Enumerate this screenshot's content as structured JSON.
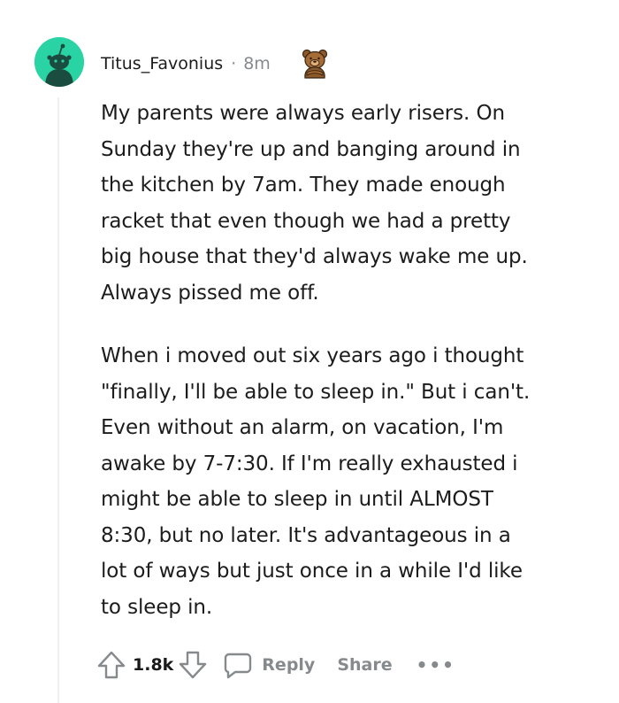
{
  "comment": {
    "author": "Titus_Favonius",
    "separator": "·",
    "timestamp": "8m",
    "award_icon": "bear-award-icon",
    "avatar_color": "#29d3a4",
    "paragraphs": [
      "My parents were always early risers. On\nSunday they're up and banging around in\nthe kitchen by 7am. They made enough\nracket that even though we had a pretty\nbig house that they'd always wake me up.\nAlways pissed me off.",
      "When i moved out six years ago i thought\n\"finally, I'll be able to sleep in.\" But i can't.\nEven without an alarm, on vacation, I'm\nawake by 7-7:30. If I'm really exhausted i\nmight be able to sleep in until ALMOST\n8:30, but no later. It's advantageous in a\nlot of ways but just once in a while I'd like\nto sleep in."
    ]
  },
  "actions": {
    "vote_count": "1.8k",
    "reply_label": "Reply",
    "share_label": "Share",
    "more_label": "•••"
  }
}
